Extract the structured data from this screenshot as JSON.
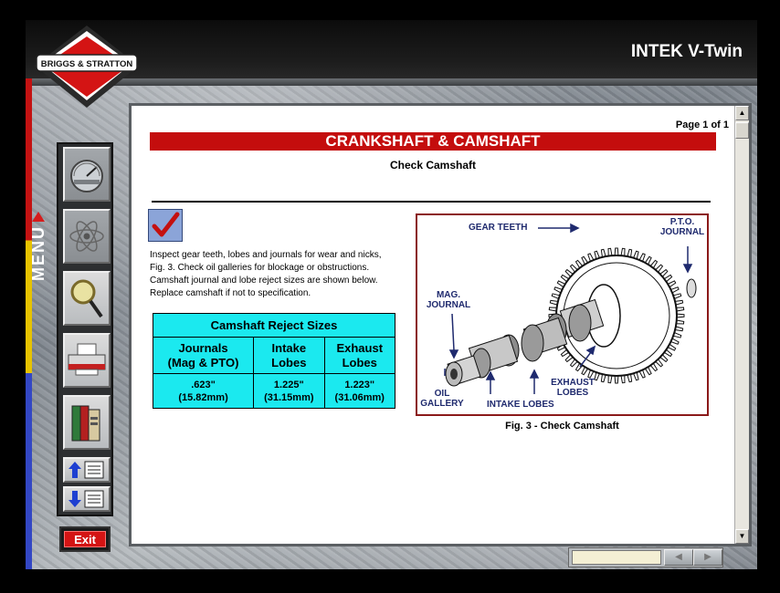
{
  "brand": {
    "logo_text": "BRIGGS & STRATTON"
  },
  "header": {
    "app_title": "INTEK V-Twin"
  },
  "sidebar": {
    "menu_label": "MENU",
    "exit_label": "Exit",
    "tools": [
      {
        "name": "gauge-icon"
      },
      {
        "name": "atom-icon"
      },
      {
        "name": "magnifier-icon"
      },
      {
        "name": "printer-icon"
      },
      {
        "name": "books-icon"
      },
      {
        "name": "page-up-icon"
      },
      {
        "name": "page-down-icon"
      }
    ]
  },
  "document": {
    "page_indicator": "Page 1 of 1",
    "title": "CRANKSHAFT & CAMSHAFT",
    "subtitle": "Check Camshaft",
    "instructions": "Inspect gear teeth, lobes and journals for wear and nicks, Fig. 3. Check oil galleries for blockage or obstructions. Camshaft journal and lobe reject sizes are shown below. Replace camshaft if not to specification.",
    "table": {
      "title": "Camshaft Reject Sizes",
      "columns": [
        "Journals (Mag & PTO)",
        "Intake Lobes",
        "Exhaust Lobes"
      ],
      "values": [
        "<br>",
        "<br>",
        "<br>"
      ],
      "col1": [
        "Journals",
        "(Mag & PTO)"
      ],
      "col2": [
        "Intake",
        "Lobes"
      ],
      "col3": [
        "Exhaust",
        "Lobes"
      ],
      "val1": [
        ".623\"",
        "(15.82mm)"
      ],
      "val2": [
        "1.225\"",
        "(31.15mm)"
      ],
      "val3": [
        "1.223\"",
        "(31.06mm)"
      ]
    },
    "figure": {
      "caption": "Fig. 3 - Check Camshaft",
      "labels": {
        "gear_teeth": "GEAR TEETH",
        "pto_journal_1": "P.T.O.",
        "pto_journal_2": "JOURNAL",
        "mag_journal_1": "MAG.",
        "mag_journal_2": "JOURNAL",
        "oil_gallery_1": "OIL",
        "oil_gallery_2": "GALLERY",
        "intake_lobes": "INTAKE LOBES",
        "exhaust_lobes_1": "EXHAUST",
        "exhaust_lobes_2": "LOBES"
      }
    }
  },
  "colors": {
    "title_bar": "#c40d0d",
    "table_bg": "#1be9ef",
    "menu_red": "#c41212",
    "menu_yellow": "#e7c300",
    "menu_blue": "#3347c4"
  }
}
